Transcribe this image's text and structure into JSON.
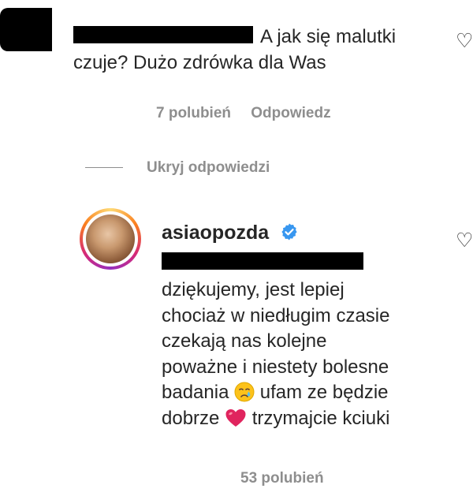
{
  "comment1": {
    "text_line1": "A jak się malutki",
    "text_line2": "czuje? Dużo zdrówka dla Was",
    "likes": "7 polubień",
    "reply_label": "Odpowiedz"
  },
  "replies_toggle": {
    "label": "Ukryj odpowiedzi"
  },
  "reply1": {
    "username": "asiaopozda",
    "verified": true,
    "lines": [
      "dziękujemy, jest lepiej",
      "chociaż w niedługim czasie",
      "czekają nas kolejne",
      "poważne i niestety bolesne"
    ],
    "line5_before": "badania",
    "line5_after": "ufam ze będzie",
    "line6_before": "dobrze",
    "line6_after": "trzymajcie kciuki",
    "likes": "53 polubień",
    "emoji": [
      "crying-face",
      "red-heart"
    ]
  },
  "colors": {
    "text": "#262626",
    "secondary": "#8e8e8e",
    "verified": "#3897f0",
    "heart_emoji": "#e0245e"
  }
}
